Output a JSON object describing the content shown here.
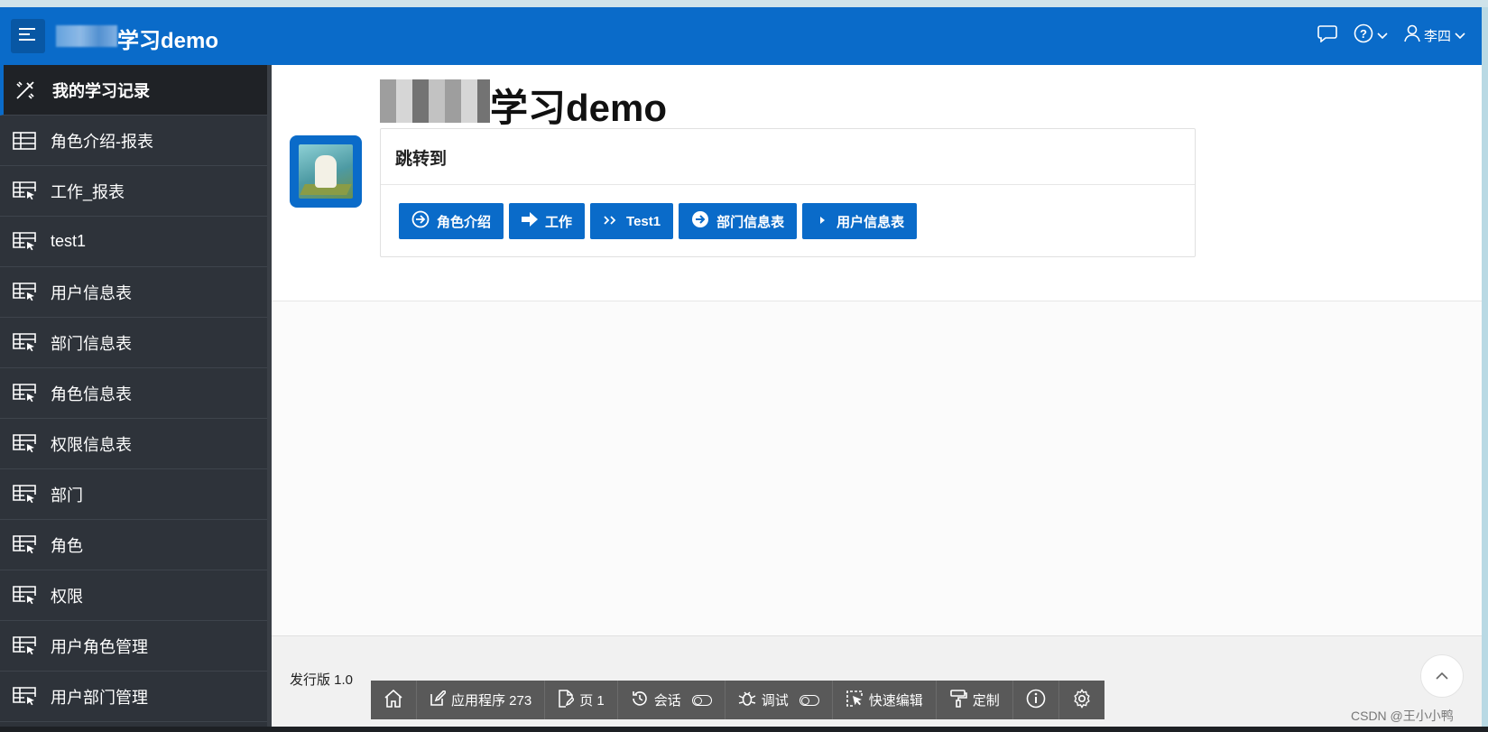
{
  "header": {
    "title": "学习demo",
    "user_name": "李四",
    "icons": [
      "menu-icon",
      "chat-icon",
      "help-icon",
      "user-icon"
    ]
  },
  "sidebar": {
    "items": [
      {
        "label": "我的学习记录",
        "icon": "wand-icon",
        "active": true
      },
      {
        "label": "角色介绍-报表",
        "icon": "table-icon"
      },
      {
        "label": "工作_报表",
        "icon": "table-cursor-icon"
      },
      {
        "label": "test1",
        "icon": "table-cursor-icon"
      },
      {
        "label": "用户信息表",
        "icon": "table-cursor-icon"
      },
      {
        "label": "部门信息表",
        "icon": "table-cursor-icon"
      },
      {
        "label": "角色信息表",
        "icon": "table-cursor-icon"
      },
      {
        "label": "权限信息表",
        "icon": "table-cursor-icon"
      },
      {
        "label": "部门",
        "icon": "table-cursor-icon"
      },
      {
        "label": "角色",
        "icon": "table-cursor-icon"
      },
      {
        "label": "权限",
        "icon": "table-cursor-icon"
      },
      {
        "label": "用户角色管理",
        "icon": "table-cursor-icon"
      },
      {
        "label": "用户部门管理",
        "icon": "table-cursor-icon"
      }
    ]
  },
  "main": {
    "page_title": "学习demo",
    "region_title": "跳转到",
    "buttons": [
      {
        "label": "角色介绍",
        "icon": "circle-arrow-icon"
      },
      {
        "label": "工作",
        "icon": "arrow-right-icon"
      },
      {
        "label": "Test1",
        "icon": "double-chevron-icon"
      },
      {
        "label": "部门信息表",
        "icon": "circle-arrow-icon"
      },
      {
        "label": "用户信息表",
        "icon": "play-small-icon"
      }
    ]
  },
  "footer": {
    "release": "发行版 1.0"
  },
  "devbar": {
    "items": [
      {
        "label": "",
        "icon": "home-icon"
      },
      {
        "label": "应用程序 273",
        "icon": "edit-icon"
      },
      {
        "label": "页 1",
        "icon": "page-edit-icon"
      },
      {
        "label": "会话",
        "icon": "session-icon",
        "toggle": true
      },
      {
        "label": "调试",
        "icon": "bug-icon",
        "toggle": true
      },
      {
        "label": "快速编辑",
        "icon": "quick-edit-icon"
      },
      {
        "label": "定制",
        "icon": "paint-roller-icon"
      },
      {
        "label": "",
        "icon": "info-icon"
      },
      {
        "label": "",
        "icon": "gear-icon"
      }
    ]
  },
  "watermark": "CSDN @王小小鸭",
  "colors": {
    "brand": "#0a6bc9",
    "sidebar": "#2e333a",
    "devbar": "#595959"
  }
}
